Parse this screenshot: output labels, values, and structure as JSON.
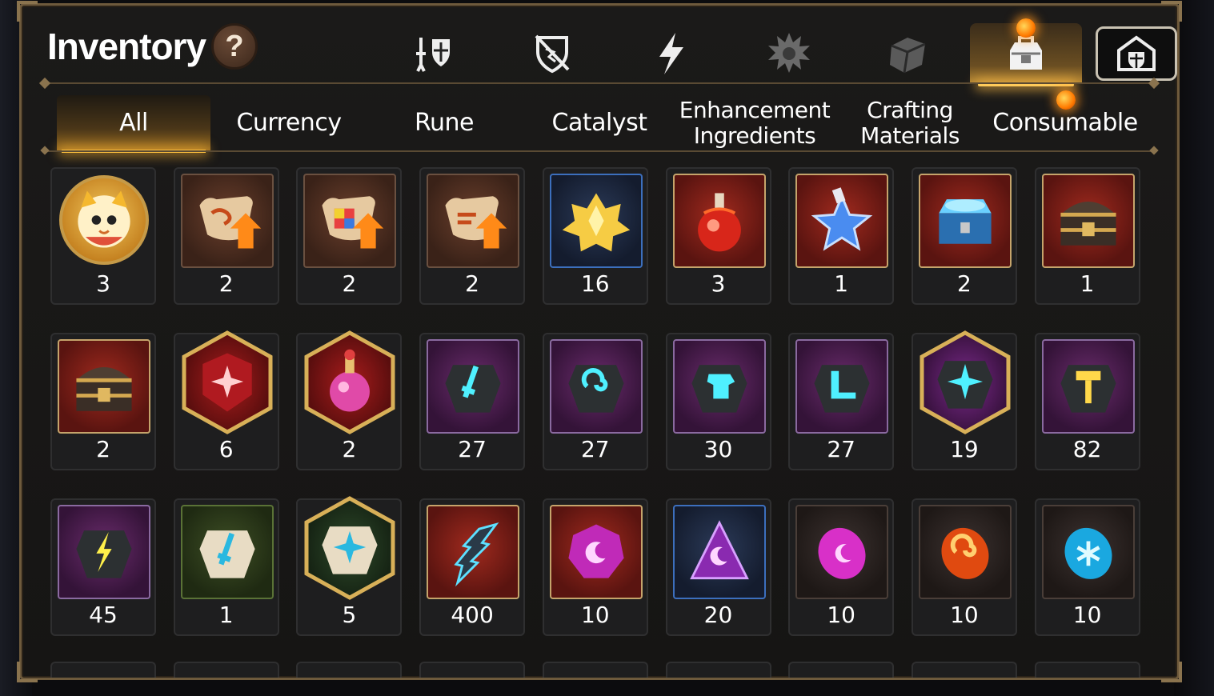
{
  "header": {
    "title": "Inventory",
    "help": "?"
  },
  "top_tabs": [
    {
      "icon": "helmet-shield-icon",
      "active": false
    },
    {
      "icon": "broken-shield-icon",
      "active": false
    },
    {
      "icon": "lightning-icon",
      "active": false
    },
    {
      "icon": "splash-emblem-icon",
      "active": false
    },
    {
      "icon": "crate-icon",
      "active": false
    },
    {
      "icon": "backpack-icon",
      "active": true,
      "badge": true
    },
    {
      "icon": "shield-house-icon",
      "active": false
    }
  ],
  "categories": [
    {
      "label": "All",
      "active": true
    },
    {
      "label": "Currency"
    },
    {
      "label": "Rune"
    },
    {
      "label": "Catalyst"
    },
    {
      "label": "Enhancement Ingredients"
    },
    {
      "label": "Crafting Materials"
    },
    {
      "label": "Consumable",
      "badge": true
    }
  ],
  "items": [
    {
      "icon": "cat-mascot-icon",
      "count": "3",
      "frame": "round"
    },
    {
      "icon": "scroll-dragon-upgrade-icon",
      "count": "2",
      "frame": "brown"
    },
    {
      "icon": "scroll-rainbow-cube-upgrade-icon",
      "count": "2",
      "frame": "brown"
    },
    {
      "icon": "scroll-upgrade-icon",
      "count": "2",
      "frame": "brown"
    },
    {
      "icon": "gold-crystal-cluster-icon",
      "count": "16",
      "frame": "blue"
    },
    {
      "icon": "red-potion-flask-icon",
      "count": "3",
      "frame": "red"
    },
    {
      "icon": "blue-star-potion-icon",
      "count": "1",
      "frame": "red"
    },
    {
      "icon": "glowing-blue-chest-icon",
      "count": "2",
      "frame": "red"
    },
    {
      "icon": "ornate-chest-icon",
      "count": "1",
      "frame": "red"
    },
    {
      "icon": "ornate-chest-icon",
      "count": "2",
      "frame": "red"
    },
    {
      "icon": "red-star-stone-icon",
      "count": "6",
      "frame": "hex-red"
    },
    {
      "icon": "pink-potion-icon",
      "count": "2",
      "frame": "hex-red"
    },
    {
      "icon": "sword-rune-stone-icon",
      "count": "27",
      "frame": "purple"
    },
    {
      "icon": "spiral-rune-stone-icon",
      "count": "27",
      "frame": "purple"
    },
    {
      "icon": "armor-rune-stone-icon",
      "count": "30",
      "frame": "purple"
    },
    {
      "icon": "boot-rune-stone-icon",
      "count": "27",
      "frame": "purple"
    },
    {
      "icon": "star-rune-stone-icon",
      "count": "19",
      "frame": "hex-purple"
    },
    {
      "icon": "hammer-rune-stone-icon",
      "count": "82",
      "frame": "purple"
    },
    {
      "icon": "lightning-rune-stone-icon",
      "count": "45",
      "frame": "purple"
    },
    {
      "icon": "pale-sword-stone-icon",
      "count": "1",
      "frame": "green"
    },
    {
      "icon": "pale-star-stone-icon",
      "count": "5",
      "frame": "hex-green"
    },
    {
      "icon": "dark-crystal-shard-icon",
      "count": "400",
      "frame": "red"
    },
    {
      "icon": "purple-moon-gem-icon",
      "count": "10",
      "frame": "red"
    },
    {
      "icon": "purple-moon-triangle-icon",
      "count": "20",
      "frame": "blue"
    },
    {
      "icon": "pink-moon-orb-icon",
      "count": "10",
      "frame": "dark"
    },
    {
      "icon": "red-swirl-orb-icon",
      "count": "10",
      "frame": "dark"
    },
    {
      "icon": "blue-snowflake-orb-icon",
      "count": "10",
      "frame": "dark"
    }
  ],
  "colors": {
    "accent": "#ffc13e",
    "frame_gold": "#c5a46b",
    "panel": "#1b1a19"
  }
}
